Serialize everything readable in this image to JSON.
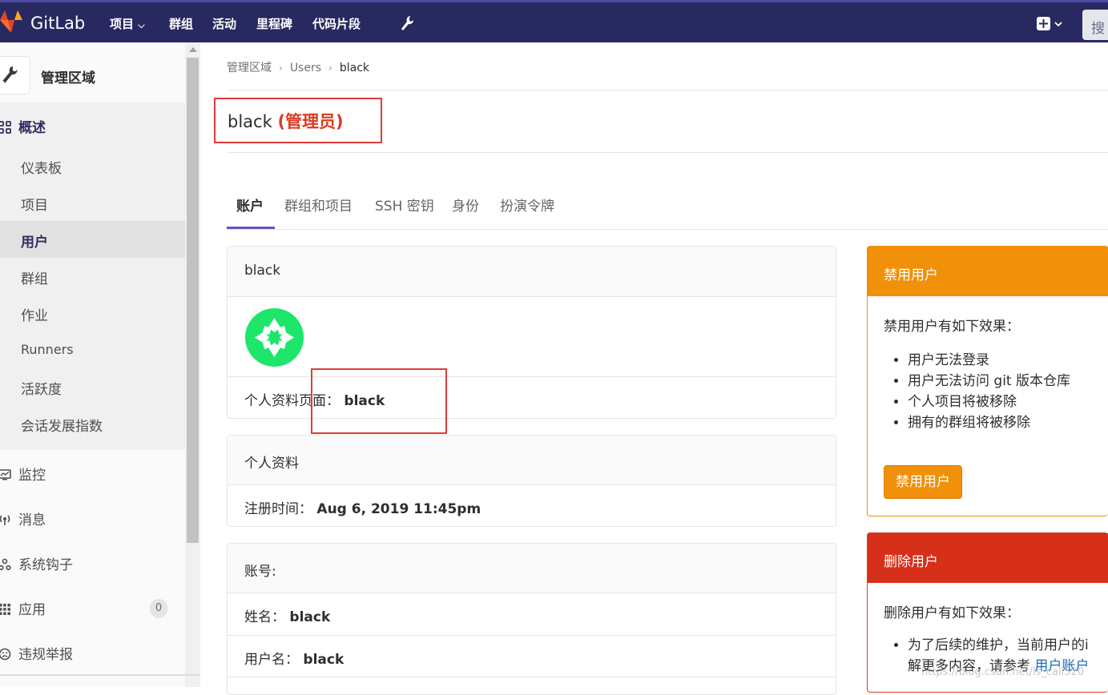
{
  "topbar": {
    "brand": "GitLab",
    "nav": [
      "项目",
      "群组",
      "活动",
      "里程碑",
      "代码片段"
    ],
    "search_label": "搜"
  },
  "sidebar": {
    "title": "管理区域",
    "overview": "概述",
    "overview_items": [
      "仪表板",
      "项目",
      "用户",
      "群组",
      "作业",
      "Runners",
      "活跃度",
      "会话发展指数"
    ],
    "items": [
      "监控",
      "消息",
      "系统钩子",
      "应用",
      "违规举报"
    ],
    "reports_count": "0"
  },
  "breadcrumb": [
    "管理区域",
    "Users",
    "black"
  ],
  "page_title": {
    "name": "black",
    "role": "(管理员)"
  },
  "tabs": [
    "账户",
    "群组和项目",
    "SSH 密钥",
    "身份",
    "扮演令牌"
  ],
  "account_card": {
    "header": "black",
    "profile_label": "个人资料页面：",
    "profile_value": "black"
  },
  "profile_card": {
    "header": "个人资料",
    "registered_label": "注册时间：",
    "registered_value": "Aug 6, 2019 11:45pm"
  },
  "id_card": {
    "header": "账号:",
    "name_label": "姓名：",
    "name_value": "black",
    "username_label": "用户名：",
    "username_value": "black"
  },
  "block_card": {
    "header": "禁用用户",
    "intro": "禁用用户有如下效果：",
    "effects": [
      "用户无法登录",
      "用户无法访问 git 版本仓库",
      "个人项目将被移除",
      "拥有的群组将被移除"
    ],
    "button": "禁用用户"
  },
  "delete_card": {
    "header": "删除用户",
    "intro": "删除用户有如下效果：",
    "effect_line1": "为了后续的维护，当前用户的i",
    "effect_line2_prefix": "解更多内容，请参考 ",
    "effect_link": "用户账户"
  },
  "watermark": "https://blog.csdn.net/ls_call520",
  "colors": {
    "topbar": "#292961",
    "warning": "#f19009",
    "danger": "#d6301a",
    "accent": "#6b4fbb"
  }
}
